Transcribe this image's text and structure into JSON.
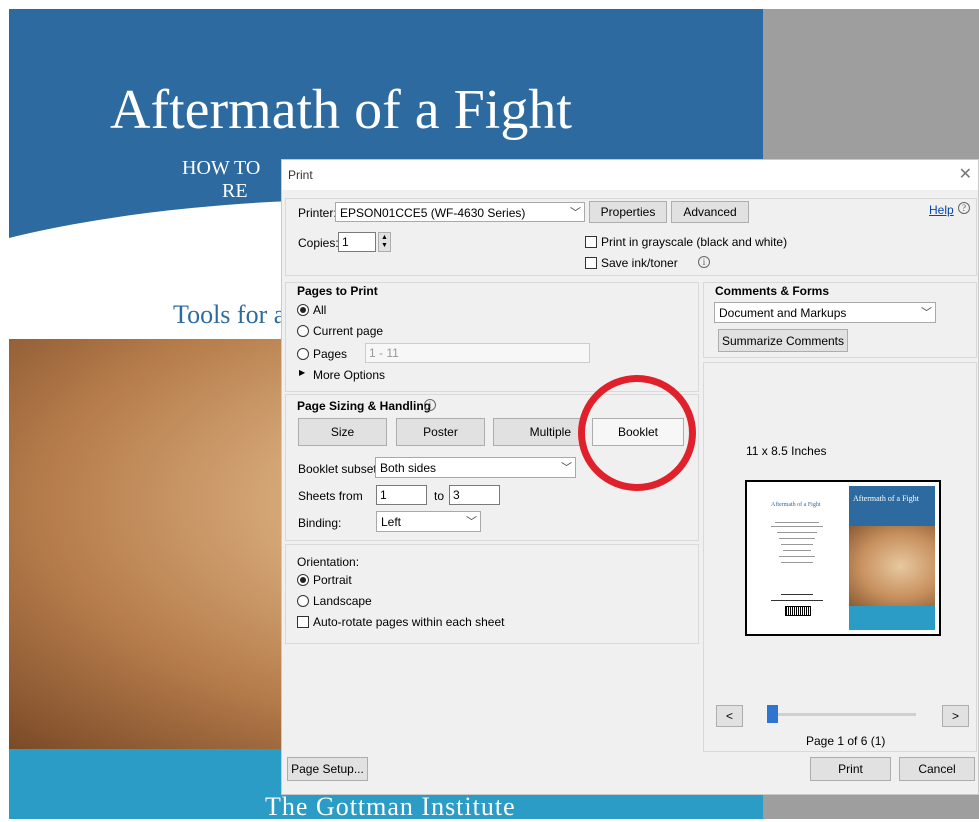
{
  "background": {
    "title": "Aftermath of a Fight",
    "subtitle_line1": "HOW TO",
    "subtitle_line2": "RE",
    "tagline": "Tools for a",
    "footer": "The Gottman Institute"
  },
  "dialog": {
    "title": "Print",
    "close_glyph": "✕",
    "printer_label": "Printer:",
    "printer_value": "EPSON01CCE5 (WF-4630 Series)",
    "properties_label": "Properties",
    "advanced_label": "Advanced",
    "help_label": "Help",
    "copies_label": "Copies:",
    "copies_value": "1",
    "grayscale_label": "Print in grayscale (black and white)",
    "save_ink_label": "Save ink/toner",
    "pages_to_print": {
      "heading": "Pages to Print",
      "all_label": "All",
      "current_label": "Current page",
      "pages_label": "Pages",
      "pages_value": "1 - 11",
      "more_options_label": "More Options"
    },
    "page_sizing": {
      "heading": "Page Sizing & Handling",
      "tabs": [
        "Size",
        "Poster",
        "Multiple",
        "Booklet"
      ],
      "active_tab": "Booklet",
      "booklet_subset_label": "Booklet subset:",
      "booklet_subset_value": "Both sides",
      "sheets_from_label": "Sheets from",
      "sheets_from_value": "1",
      "to_label": "to",
      "sheets_to_value": "3",
      "binding_label": "Binding:",
      "binding_value": "Left"
    },
    "orientation": {
      "heading": "Orientation:",
      "portrait_label": "Portrait",
      "landscape_label": "Landscape",
      "autorotate_label": "Auto-rotate pages within each sheet"
    },
    "comments_forms": {
      "heading": "Comments & Forms",
      "value": "Document and Markups",
      "summarize_label": "Summarize Comments"
    },
    "preview": {
      "size_label": "11 x 8.5 Inches",
      "thumb_title_left": "Aftermath of a Fight",
      "thumb_title_right": "Aftermath of a Fight",
      "prev_label": "<",
      "next_label": ">",
      "page_status": "Page 1 of 6 (1)"
    },
    "page_setup_label": "Page Setup...",
    "print_label": "Print",
    "cancel_label": "Cancel"
  },
  "colors": {
    "cover_blue": "#2c6aa0",
    "cover_cyan": "#2a9cc5",
    "annotation_red": "#e0212b",
    "dialog_bg": "#f0f0f0"
  }
}
